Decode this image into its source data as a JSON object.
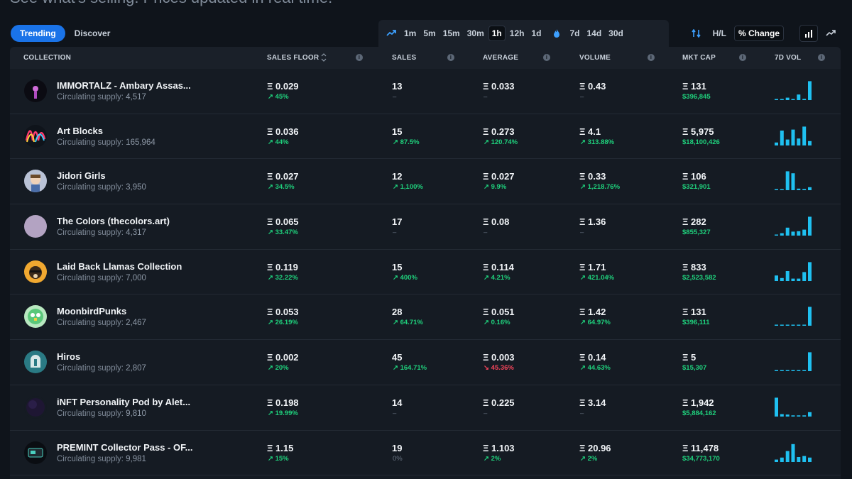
{
  "header": {
    "subtitle": "See what's selling. Prices updated in real time."
  },
  "tabs": [
    {
      "label": "Trending",
      "active": true
    },
    {
      "label": "Discover",
      "active": false
    }
  ],
  "timeframes": {
    "short": [
      "1m",
      "5m",
      "15m",
      "30m",
      "1h",
      "12h",
      "1d"
    ],
    "long": [
      "7d",
      "14d",
      "30d"
    ],
    "selected": "1h"
  },
  "controls": {
    "hl": "H/L",
    "pct": "% Change"
  },
  "columns": {
    "collection": "COLLECTION",
    "sales_floor": "SALES FLOOR",
    "sales": "SALES",
    "average": "AVERAGE",
    "volume": "VOLUME",
    "mkt_cap": "MKT CAP",
    "vol7d": "7D VOL"
  },
  "supply_label": "Circulating supply:",
  "eth": "Ξ",
  "colors": {
    "accent": "#1a73e8",
    "up": "#1fd07c",
    "down": "#f0445a",
    "bar": "#1fc0f0"
  },
  "rows": [
    {
      "name": "IMMORTALZ - Ambary Assas...",
      "supply": "4,517",
      "avatar": "immortalz-avatar",
      "floor": "0.029",
      "floor_chg": "45%",
      "floor_dir": "up",
      "sales": "13",
      "sales_chg": "–",
      "sales_dir": "neutral",
      "avg": "0.033",
      "avg_chg": "–",
      "avg_dir": "neutral",
      "vol": "0.43",
      "vol_chg": "–",
      "vol_dir": "neutral",
      "mcap": "131",
      "mcap_usd": "$396,845",
      "bars": [
        0.04,
        0.04,
        0.12,
        0.04,
        0.28,
        0.06,
        0.95
      ]
    },
    {
      "name": "Art Blocks",
      "supply": "165,964",
      "avatar": "artblocks-avatar",
      "floor": "0.036",
      "floor_chg": "44%",
      "floor_dir": "up",
      "sales": "15",
      "sales_chg": "87.5%",
      "sales_dir": "up",
      "avg": "0.273",
      "avg_chg": "120.74%",
      "avg_dir": "up",
      "vol": "4.1",
      "vol_chg": "313.88%",
      "vol_dir": "up",
      "mcap": "5,975",
      "mcap_usd": "$18,100,426",
      "bars": [
        0.15,
        0.75,
        0.3,
        0.8,
        0.35,
        0.95,
        0.22
      ]
    },
    {
      "name": "Jidori Girls",
      "supply": "3,950",
      "avatar": "jidori-avatar",
      "floor": "0.027",
      "floor_chg": "34.5%",
      "floor_dir": "up",
      "sales": "12",
      "sales_chg": "1,100%",
      "sales_dir": "up",
      "avg": "0.027",
      "avg_chg": "9.9%",
      "avg_dir": "up",
      "vol": "0.33",
      "vol_chg": "1,218.76%",
      "vol_dir": "up",
      "mcap": "106",
      "mcap_usd": "$321,901",
      "bars": [
        0.04,
        0.04,
        0.95,
        0.85,
        0.08,
        0.06,
        0.15
      ]
    },
    {
      "name": "The Colors (thecolors.art)",
      "supply": "4,317",
      "avatar": "thecolors-avatar",
      "floor": "0.065",
      "floor_chg": "33.47%",
      "floor_dir": "up",
      "sales": "17",
      "sales_chg": "–",
      "sales_dir": "neutral",
      "avg": "0.08",
      "avg_chg": "–",
      "avg_dir": "neutral",
      "vol": "1.36",
      "vol_chg": "–",
      "vol_dir": "neutral",
      "mcap": "282",
      "mcap_usd": "$855,327",
      "bars": [
        0.04,
        0.12,
        0.4,
        0.2,
        0.22,
        0.3,
        0.95
      ]
    },
    {
      "name": "Laid Back Llamas Collection",
      "supply": "7,000",
      "avatar": "llamas-avatar",
      "floor": "0.119",
      "floor_chg": "32.22%",
      "floor_dir": "up",
      "sales": "15",
      "sales_chg": "400%",
      "sales_dir": "up",
      "avg": "0.114",
      "avg_chg": "4.21%",
      "avg_dir": "up",
      "vol": "1.71",
      "vol_chg": "421.04%",
      "vol_dir": "up",
      "mcap": "833",
      "mcap_usd": "$2,523,582",
      "bars": [
        0.28,
        0.15,
        0.5,
        0.12,
        0.12,
        0.45,
        0.95
      ]
    },
    {
      "name": "MoonbirdPunks",
      "supply": "2,467",
      "avatar": "moonbirdpunks-avatar",
      "floor": "0.053",
      "floor_chg": "26.19%",
      "floor_dir": "up",
      "sales": "28",
      "sales_chg": "64.71%",
      "sales_dir": "up",
      "avg": "0.051",
      "avg_chg": "0.16%",
      "avg_dir": "up",
      "vol": "1.42",
      "vol_chg": "64.97%",
      "vol_dir": "up",
      "mcap": "131",
      "mcap_usd": "$396,111",
      "bars": [
        0.04,
        0.04,
        0.04,
        0.04,
        0.04,
        0.04,
        0.95
      ]
    },
    {
      "name": "Hiros",
      "supply": "2,807",
      "avatar": "hiros-avatar",
      "floor": "0.002",
      "floor_chg": "20%",
      "floor_dir": "up",
      "sales": "45",
      "sales_chg": "164.71%",
      "sales_dir": "up",
      "avg": "0.003",
      "avg_chg": "45.36%",
      "avg_dir": "down",
      "vol": "0.14",
      "vol_chg": "44.63%",
      "vol_dir": "up",
      "mcap": "5",
      "mcap_usd": "$15,307",
      "bars": [
        0.04,
        0.04,
        0.04,
        0.04,
        0.04,
        0.04,
        0.95
      ]
    },
    {
      "name": "iNFT Personality Pod by Alet...",
      "supply": "9,810",
      "avatar": "inft-avatar",
      "floor": "0.198",
      "floor_chg": "19.99%",
      "floor_dir": "up",
      "sales": "14",
      "sales_chg": "–",
      "sales_dir": "neutral",
      "avg": "0.225",
      "avg_chg": "–",
      "avg_dir": "neutral",
      "vol": "3.14",
      "vol_chg": "–",
      "vol_dir": "neutral",
      "mcap": "1,942",
      "mcap_usd": "$5,884,162",
      "bars": [
        0.95,
        0.12,
        0.1,
        0.06,
        0.06,
        0.06,
        0.22
      ]
    },
    {
      "name": "PREMINT Collector Pass - OF...",
      "supply": "9,981",
      "avatar": "premint-avatar",
      "floor": "1.15",
      "floor_chg": "15%",
      "floor_dir": "up",
      "sales": "19",
      "sales_chg": "0%",
      "sales_dir": "neutral",
      "avg": "1.103",
      "avg_chg": "2%",
      "avg_dir": "up",
      "vol": "20.96",
      "vol_chg": "2%",
      "vol_dir": "up",
      "mcap": "11,478",
      "mcap_usd": "$34,773,170",
      "bars": [
        0.12,
        0.22,
        0.55,
        0.9,
        0.25,
        0.3,
        0.22
      ]
    }
  ]
}
